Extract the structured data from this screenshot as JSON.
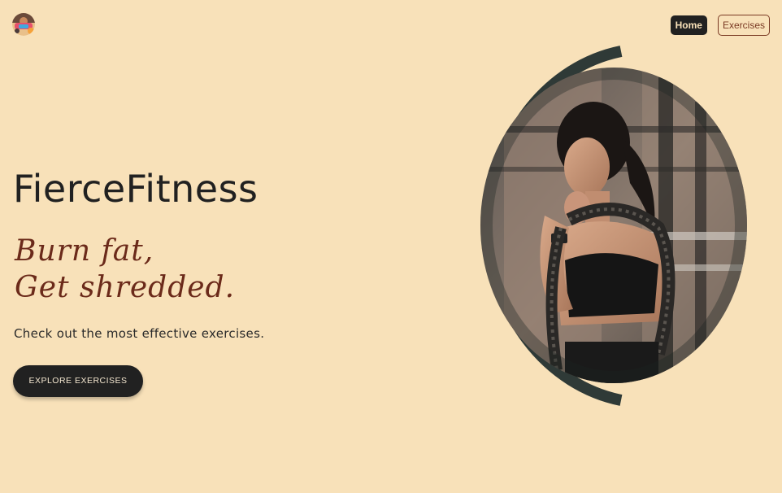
{
  "header": {
    "logo_icon": "fitness-avatar-icon",
    "nav": {
      "home_label": "Home",
      "exercises_label": "Exercises"
    }
  },
  "hero": {
    "brand": "FierceFitness",
    "tagline_line1": "Burn fat,",
    "tagline_line2": "Get shredded.",
    "subtitle": "Check out the most effective exercises.",
    "cta_label": "EXPLORE EXERCISES",
    "image_icon": "woman-with-battle-rope-photo"
  },
  "colors": {
    "background": "#f8e1b9",
    "dark": "#212121",
    "accent": "#6b2a1a",
    "ring": "#2f3a37"
  }
}
